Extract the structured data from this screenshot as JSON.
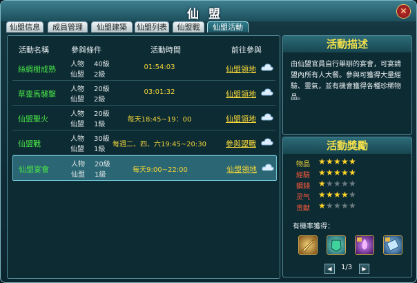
{
  "window": {
    "title": "仙盟",
    "close_label": "✕"
  },
  "tabs": [
    {
      "label": "仙盟信息",
      "active": false
    },
    {
      "label": "成員管理",
      "active": false
    },
    {
      "label": "仙盟建築",
      "active": false
    },
    {
      "label": "仙盟列表",
      "active": false
    },
    {
      "label": "仙盟戰",
      "active": false
    },
    {
      "label": "仙盟活動",
      "active": true
    }
  ],
  "table": {
    "headers": [
      "活動名稱",
      "參與條件",
      "活動時間",
      "前往參與"
    ],
    "rows": [
      {
        "name": "絲綢樹成熟",
        "req": [
          {
            "k": "人物",
            "v": "40級"
          },
          {
            "k": "仙盟",
            "v": "2級"
          }
        ],
        "time": "01:54:03",
        "action": "仙盟領地"
      },
      {
        "name": "草靈馬襲擊",
        "req": [
          {
            "k": "人物",
            "v": "20級"
          },
          {
            "k": "仙盟",
            "v": "2級"
          }
        ],
        "time": "03:01:32",
        "action": "仙盟領地"
      },
      {
        "name": "仙盟聖火",
        "req": [
          {
            "k": "人物",
            "v": "20級"
          },
          {
            "k": "仙盟",
            "v": "1級"
          }
        ],
        "time": "每天18:45~19：00",
        "action": "仙盟領地"
      },
      {
        "name": "仙盟戰",
        "req": [
          {
            "k": "人物",
            "v": "30級"
          },
          {
            "k": "仙盟",
            "v": "1級"
          }
        ],
        "time": "每週二、四、六19:45~20:30",
        "action": "參與盟戰"
      },
      {
        "name": "仙盟宴會",
        "req": [
          {
            "k": "人物",
            "v": "20級"
          },
          {
            "k": "仙盟",
            "v": "1級"
          }
        ],
        "time": "每天9:00~22:00",
        "action": "仙盟領地",
        "selected": true
      }
    ],
    "icons": {
      "cloud": "cloud-icon"
    }
  },
  "description": {
    "title": "活動描述",
    "text": "由仙盟官員自行舉辦的宴會，可宴請盟內所有人大餐。參與可獲得大量經驗、靈氣，並有機會獲得各種珍稀物品。"
  },
  "rewards": {
    "title": "活動獎勵",
    "items": [
      {
        "label": "物品",
        "color": "#f2d43a",
        "stars": 5
      },
      {
        "label": "經驗",
        "color": "#ff5a3a",
        "stars": 5
      },
      {
        "label": "鋼錢",
        "color": "#ff5a3a",
        "stars": 1
      },
      {
        "label": "灵气",
        "color": "#ff5a3a",
        "stars": 4
      },
      {
        "label": "贡献",
        "color": "#ff5a3a",
        "stars": 1
      }
    ],
    "max_stars": 5,
    "probable_label": "有機率獲得：",
    "reward_icons": [
      "golden-sword-icon",
      "jade-armor-icon",
      "purple-flame-lock-icon",
      "blue-scroll-lock-icon"
    ],
    "page": "1/3",
    "prev_label": "◀",
    "next_label": "▶"
  },
  "colors": {
    "accent": "#f2d43a",
    "activity_name": "#48e248",
    "star_on": "#ffd52a"
  }
}
